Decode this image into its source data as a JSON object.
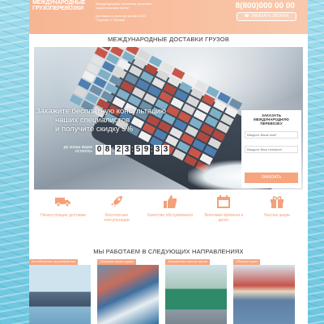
{
  "header": {
    "logo_line1": "МЕЖДУНАРОДНЫЕ",
    "logo_line2": "ГРУЗОПЕРЕВОЗКИ",
    "tagline": "Международная логистика: доставка грузов морским путем",
    "address": "Доставка по всем регионам ООО \"Сертекс\" г. Москва",
    "phone": "8(800)000 00 00",
    "callback_label": "ЗАКАЗАТЬ ЗВОНОК"
  },
  "hero": {
    "section_title": "МЕЖДУНАРОДНЫЕ ДОСТАВКИ ГРУЗОВ",
    "offer_line1": "Закажите бесплатную консультацию",
    "offer_line2": "наших специалистов",
    "offer_line3": "и получите скидку 5%",
    "timer_label": "до конца акции осталось",
    "timer_digits": [
      "0",
      "8",
      "2",
      "3",
      "5",
      "9",
      "3",
      "3"
    ],
    "form": {
      "title": "ЗАКАЗАТЬ МЕЖДУНАРОДНУЮ ПЕРЕВОЗКУ",
      "name_placeholder": "Введите Ваше имя*",
      "phone_placeholder": "Введите Ваш телефон*",
      "submit_label": "ЗАКАЗАТЬ"
    }
  },
  "features": [
    {
      "label": "Низкостоящие доставки",
      "icon": "truck-icon"
    },
    {
      "label": "Бесплатные консультации",
      "icon": "rocket-icon"
    },
    {
      "label": "Качество обслуживания",
      "icon": "thumbs-up-icon"
    },
    {
      "label": "Экономия времени и денег",
      "icon": "calendar-icon"
    },
    {
      "label": "Частые акции",
      "icon": "gift-icon"
    }
  ],
  "directions": {
    "section_title": "МЫ РАБОТАЕМ В СЛЕДУЮЩИХ НАПРАВЛЕНИЯХ",
    "cards": [
      {
        "label": "Контейнерные грузоперевозки"
      },
      {
        "label": "Сезонные грузы и дары"
      },
      {
        "label": "Таможенная очистка грузов"
      },
      {
        "label": "Сборные грузы"
      }
    ]
  },
  "colors": {
    "accent": "#f6a57f",
    "header": "#f7b592",
    "background": "#7fcfe3"
  }
}
